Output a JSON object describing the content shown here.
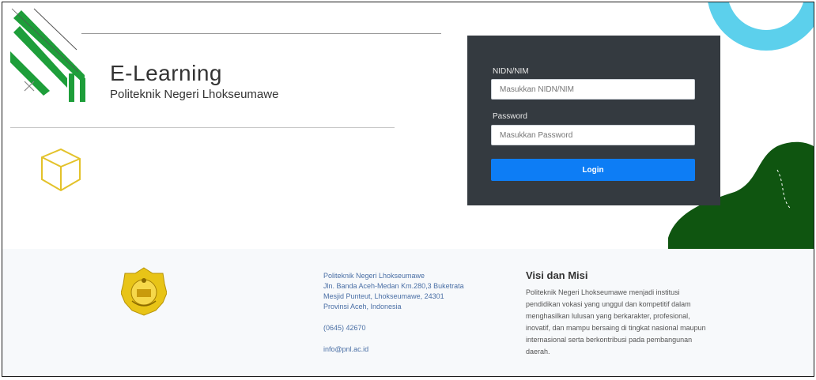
{
  "brand": {
    "title": "E-Learning",
    "subtitle": "Politeknik Negeri Lhokseumawe"
  },
  "login": {
    "username_label": "NIDN/NIM",
    "username_placeholder": "Masukkan NIDN/NIM",
    "password_label": "Password",
    "password_placeholder": "Masukkan Password",
    "submit_label": "Login"
  },
  "footer": {
    "address_name": "Politeknik Negeri Lhokseumawe",
    "address_street": "Jln. Banda Aceh-Medan Km.280,3 Buketrata",
    "address_city": "Mesjid Punteut, Lhokseumawe, 24301",
    "address_country": "Provinsi Aceh, Indonesia",
    "phone": "(0645) 42670",
    "email": "info@pnl.ac.id",
    "visi_title": "Visi dan Misi",
    "visi_text": "Politeknik Negeri Lhokseumawe menjadi institusi pendidikan vokasi yang unggul dan kompetitif dalam menghasilkan lulusan yang berkarakter, profesional, inovatif, dan mampu bersaing di tingkat nasional maupun internasional serta berkontribusi pada pembangunan daerah."
  },
  "colors": {
    "panel": "#343a40",
    "button": "#0d7df5",
    "accent_green": "#1e9e3a",
    "blob_green": "#0f5510",
    "ring_blue": "#5cd0ec",
    "cube_yellow": "#e3c22a"
  }
}
